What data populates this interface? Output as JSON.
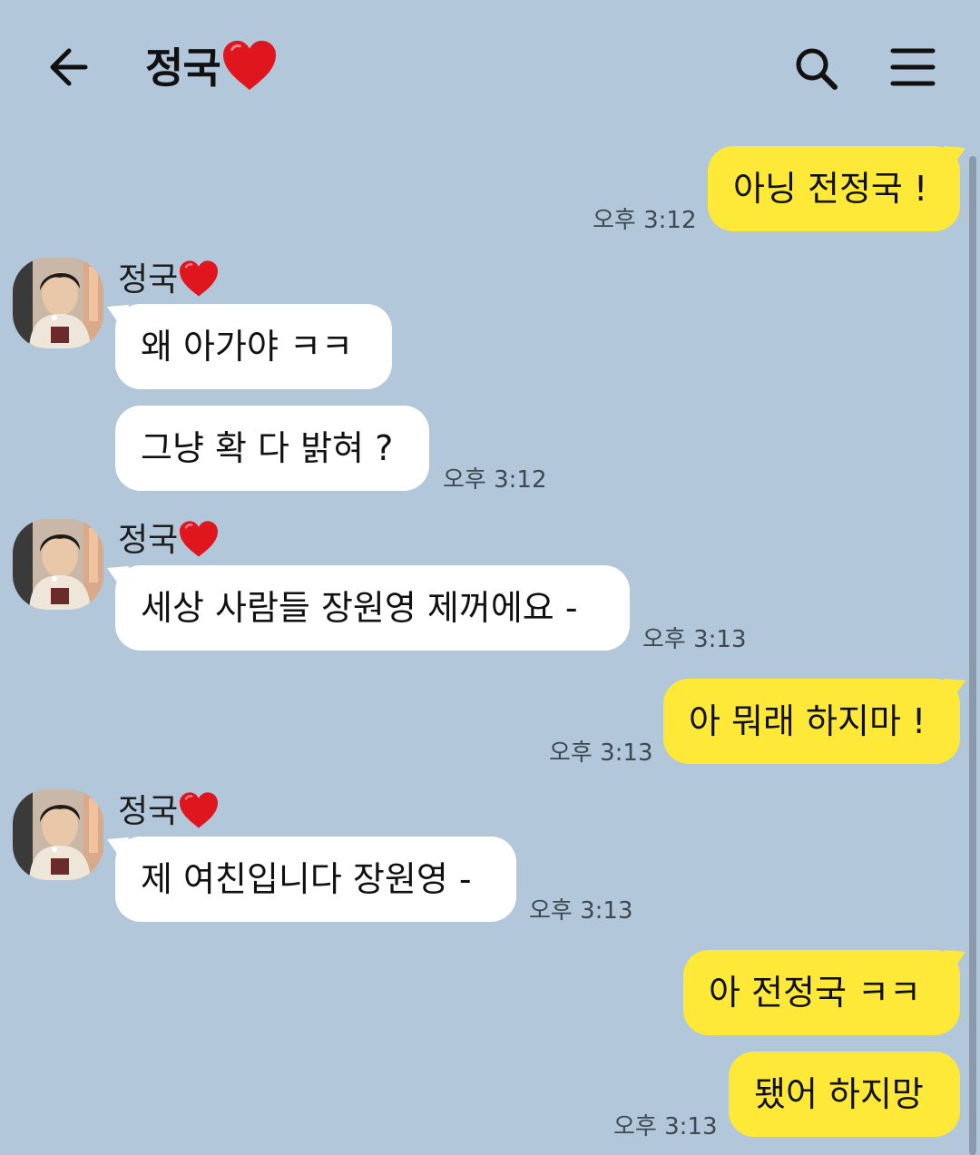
{
  "header": {
    "title": "정국",
    "back_icon": "arrow-left-icon",
    "search_icon": "search-icon",
    "menu_icon": "hamburger-menu-icon"
  },
  "colors": {
    "background": "#b2c7da",
    "my_bubble": "#fee939",
    "their_bubble": "#ffffff"
  },
  "messages": [
    {
      "from": "me",
      "text": "아닝 전정국 !",
      "time": "오후 3:12"
    },
    {
      "from": "them",
      "sender": "정국",
      "text": "왜 아가야 ㅋㅋ",
      "time": ""
    },
    {
      "from": "them",
      "text": "그냥 확 다 밝혀 ?",
      "time": "오후 3:12"
    },
    {
      "from": "them",
      "sender": "정국",
      "text": "세상 사람들 장원영 제꺼에요 -",
      "time": "오후 3:13"
    },
    {
      "from": "me",
      "text": "아 뭐래 하지마 !",
      "time": "오후 3:13"
    },
    {
      "from": "them",
      "sender": "정국",
      "text": "제 여친입니다 장원영 -",
      "time": "오후 3:13"
    },
    {
      "from": "me",
      "text": "아 전정국 ㅋㅋ",
      "time": ""
    },
    {
      "from": "me",
      "text": "됐어 하지망",
      "time": "오후 3:13"
    }
  ]
}
